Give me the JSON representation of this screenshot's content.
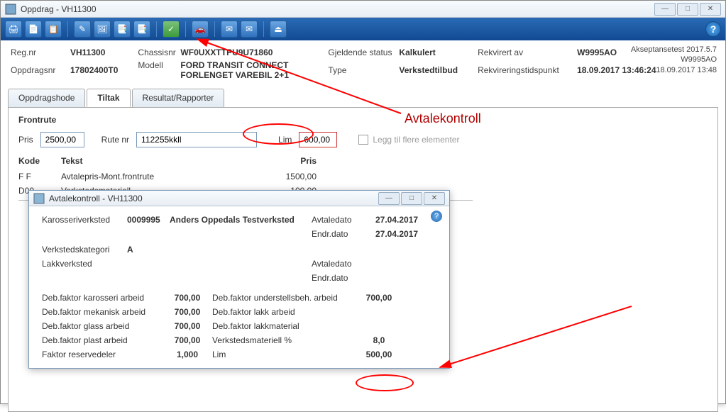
{
  "main": {
    "title": "Oppdrag - VH11300",
    "header": {
      "regnr_label": "Reg.nr",
      "regnr": "VH11300",
      "oppdragsnr_label": "Oppdragsnr",
      "oppdragsnr": "17802400T0",
      "chassisnr_label": "Chassisnr",
      "chassisnr": "WF0UXXTTPU9U71860",
      "modell_label": "Modell",
      "modell": "FORD TRANSIT CONNECT FORLENGET VAREBIL 2+1",
      "status_label": "Gjeldende status",
      "status": "Kalkulert",
      "type_label": "Type",
      "type": "Verkstedtilbud",
      "rekvirert_label": "Rekvirert av",
      "rekvirert": "W9995AO",
      "rekv_time_label": "Rekvireringstidspunkt",
      "rekv_time": "18.09.2017 13:46:24"
    },
    "meta": {
      "line1": "Akseptansetest 2017.5.7",
      "line2": "W9995AO",
      "line3": "18.09.2017 13:48"
    },
    "tabs": {
      "t1": "Oppdragshode",
      "t2": "Tiltak",
      "t3": "Resultat/Rapporter"
    },
    "frontrute": {
      "title": "Frontrute",
      "pris_label": "Pris",
      "pris": "2500,00",
      "rutenr_label": "Rute nr",
      "rutenr": "112255kkll",
      "lim_label": "Lim",
      "lim": "600,00",
      "checkbox_label": "Legg til flere elementer",
      "col_kode": "Kode",
      "col_tekst": "Tekst",
      "col_pris": "Pris",
      "rows": [
        {
          "kode": "F F",
          "tekst": "Avtalepris-Mont.frontrute",
          "pris": "1500,00"
        },
        {
          "kode": "D00",
          "tekst": "Verkstedsmateriell",
          "pris": "100,00"
        }
      ]
    }
  },
  "modal": {
    "title": "Avtalekontroll - VH11300",
    "karosseri_label": "Karosseriverksted",
    "karosseri_code": "0009995",
    "karosseri_name": "Anders Oppedals Testverksted",
    "avtaledato_label": "Avtaledato",
    "avtaledato": "27.04.2017",
    "endrdato_label": "Endr.dato",
    "endrdato": "27.04.2017",
    "kategori_label": "Verkstedskategori",
    "kategori": "A",
    "lakk_label": "Lakkverksted",
    "avtaledato2_label": "Avtaledato",
    "endrdato2_label": "Endr.dato",
    "f1_label": "Deb.faktor karosseri arbeid",
    "f1_val": "700,00",
    "f1b_label": "Deb.faktor understellsbeh. arbeid",
    "f1b_val": "700,00",
    "f2_label": "Deb.faktor mekanisk arbeid",
    "f2_val": "700,00",
    "f2b_label": "Deb.faktor lakk arbeid",
    "f3_label": "Deb.faktor glass arbeid",
    "f3_val": "700,00",
    "f3b_label": "Deb.faktor lakkmaterial",
    "f4_label": "Deb.faktor plast arbeid",
    "f4_val": "700,00",
    "f4b_label": "Verkstedsmateriell %",
    "f4b_val": "8,0",
    "f5_label": "Faktor reservedeler",
    "f5_val": "1,000",
    "f5b_label": "Lim",
    "f5b_val": "500,00"
  },
  "annotation": {
    "label": "Avtalekontroll"
  }
}
